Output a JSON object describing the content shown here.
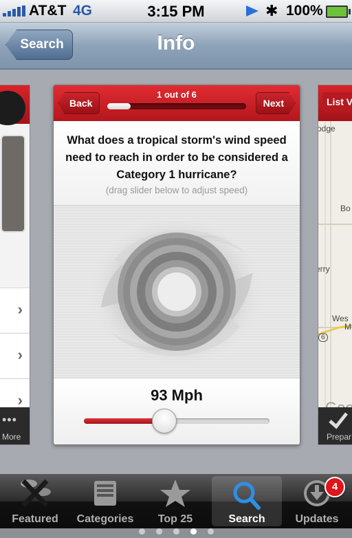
{
  "status_bar": {
    "carrier": "AT&T",
    "network": "4G",
    "time": "3:15 PM",
    "battery": "100%"
  },
  "nav": {
    "back_label": "Search",
    "title": "Info"
  },
  "quiz_card": {
    "back_label": "Back",
    "next_label": "Next",
    "progress_text": "1 out of 6",
    "progress_fraction": 0.1667,
    "question": "What does a tropical storm's wind speed need to reach in order to be considered a Category 1 hurricane?",
    "hint": "(drag slider below to adjust speed)",
    "speed_readout": "93 Mph",
    "slider_fraction": 0.43
  },
  "left_card": {
    "footer_label": "More",
    "footer_dots": "•••"
  },
  "right_card": {
    "button_label": "List V",
    "map_labels": [
      "odge",
      "Bo",
      "erry",
      "Wes",
      "M",
      "6",
      "Goo"
    ],
    "footer_label": "Prepar"
  },
  "page_dots": {
    "count": 5,
    "active_index": 3
  },
  "tab_bar": {
    "items": [
      {
        "label": "Featured",
        "icon": "featured-icon"
      },
      {
        "label": "Categories",
        "icon": "categories-icon"
      },
      {
        "label": "Top 25",
        "icon": "star-icon"
      },
      {
        "label": "Search",
        "icon": "search-icon"
      },
      {
        "label": "Updates",
        "icon": "download-icon"
      }
    ],
    "selected_index": 3,
    "updates_badge": "4"
  },
  "colors": {
    "card_header_red": "#c81f26",
    "nav_bar_blue": "#8ea3b8",
    "slider_red": "#c21c22"
  }
}
